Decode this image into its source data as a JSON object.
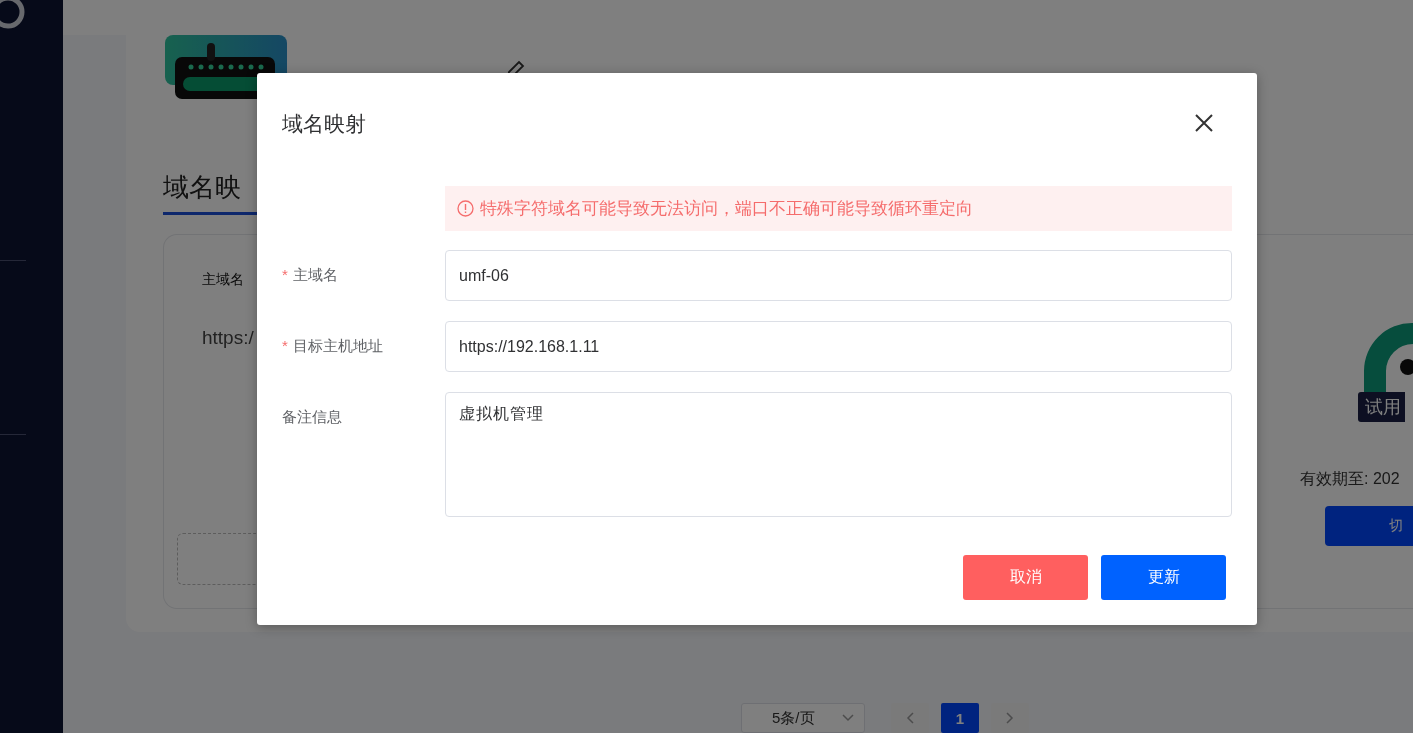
{
  "tabs": [
    {
      "label": "域名映",
      "selected": true
    }
  ],
  "mapping_card": {
    "column_label": "主域名",
    "value": "https:/"
  },
  "license": {
    "badge": "试用",
    "expiry": "有效期至: 202",
    "button": "切"
  },
  "pagination": {
    "page_size": "5条/页",
    "pages": [
      {
        "label": "1",
        "selected": true
      }
    ]
  },
  "dialog": {
    "title": "域名映射",
    "alert": "特殊字符域名可能导致无法访问，端口不正确可能导致循环重定向",
    "fields": [
      {
        "required_mark": "*",
        "label": "主域名",
        "value": "umf-06",
        "kind": "input"
      },
      {
        "required_mark": "*",
        "label": "目标主机地址",
        "value": "https://192.168.1.11",
        "kind": "input"
      },
      {
        "label": "备注信息",
        "value": "虚拟机管理",
        "kind": "textarea"
      }
    ],
    "buttons": [
      {
        "label": "取消",
        "kind": "cancel"
      },
      {
        "label": "更新",
        "kind": "primary"
      }
    ]
  }
}
